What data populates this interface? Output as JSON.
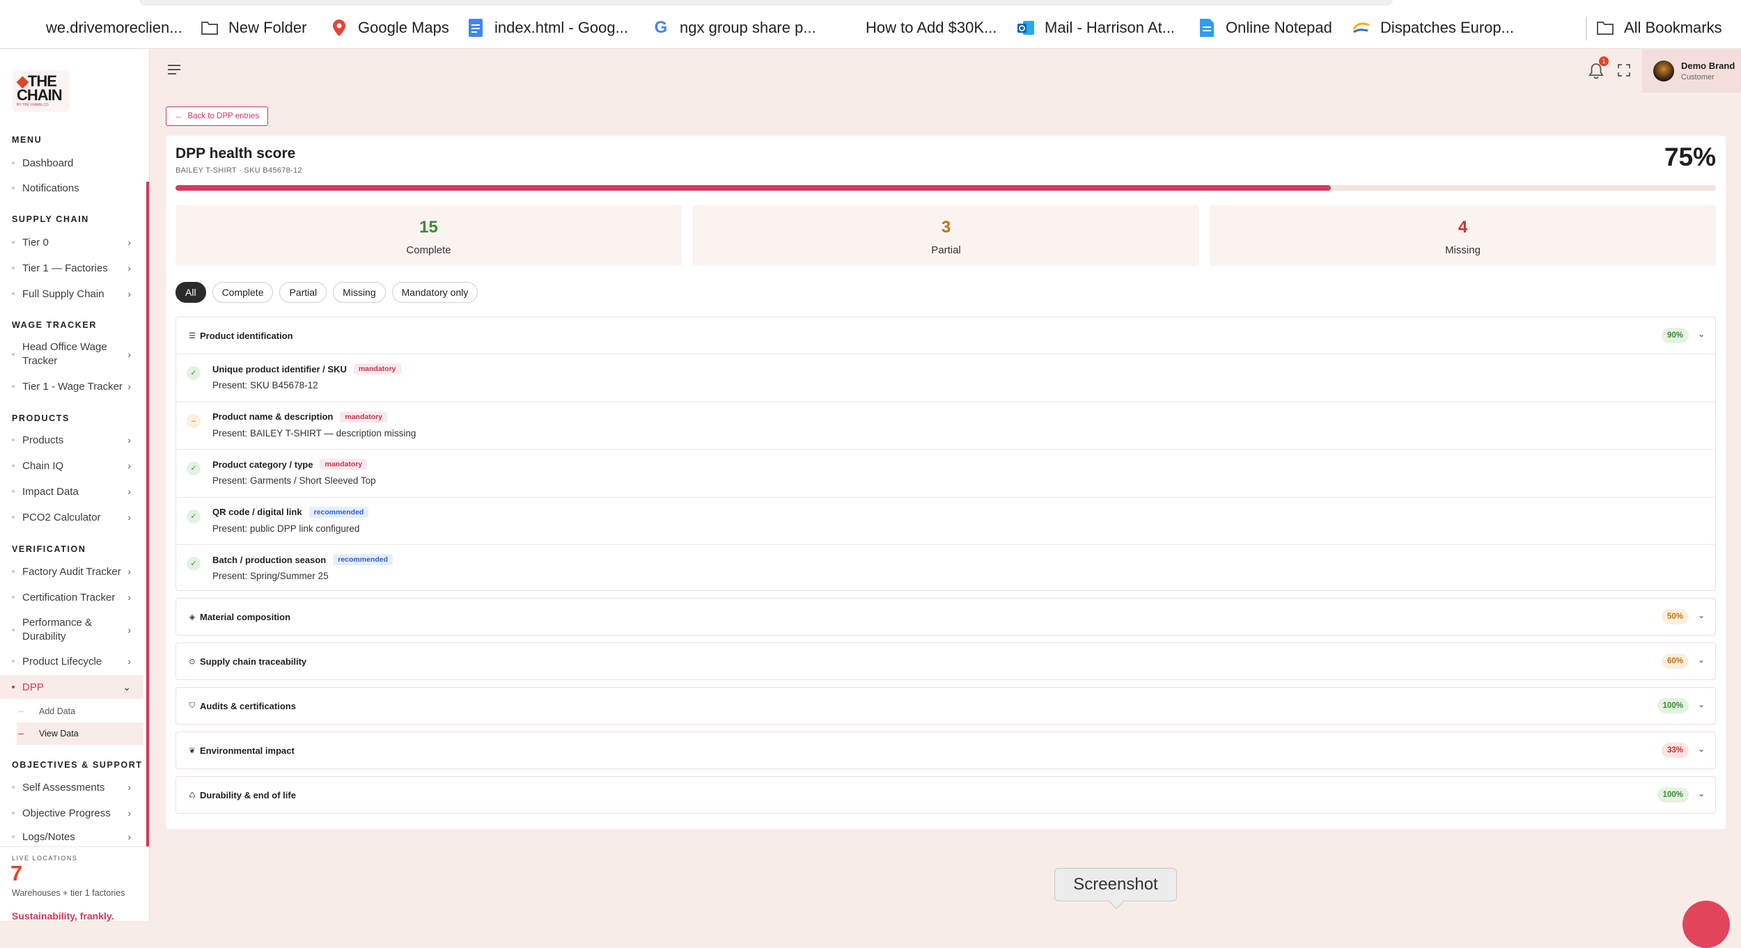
{
  "bookmarks": [
    {
      "label": "we.drivemoreclien...",
      "icon": "none"
    },
    {
      "label": "New Folder",
      "icon": "folder-icon"
    },
    {
      "label": "Google Maps",
      "icon": "maps-pin-icon"
    },
    {
      "label": "index.html - Goog...",
      "icon": "docs-icon"
    },
    {
      "label": "ngx group share p...",
      "icon": "google-g-icon"
    },
    {
      "label": "How to Add $30K...",
      "icon": "none"
    },
    {
      "label": "Mail - Harrison At...",
      "icon": "outlook-icon"
    },
    {
      "label": "Online Notepad",
      "icon": "notepad-icon"
    },
    {
      "label": "Dispatches Europ...",
      "icon": "dispatches-icon"
    },
    {
      "label": "All Bookmarks",
      "icon": "folder-icon"
    }
  ],
  "logo": {
    "line1": "THE",
    "line2": "CHAIN",
    "tagline": "BY THE FRAME.CO"
  },
  "sidebar": {
    "sections": [
      {
        "title": "MENU",
        "items": [
          {
            "label": "Dashboard"
          },
          {
            "label": "Notifications"
          }
        ]
      },
      {
        "title": "SUPPLY CHAIN",
        "items": [
          {
            "label": "Tier 0"
          },
          {
            "label": "Tier 1 — Factories"
          },
          {
            "label": "Full Supply Chain"
          }
        ]
      },
      {
        "title": "WAGE TRACKER",
        "items": [
          {
            "label": "Head Office Wage Tracker"
          },
          {
            "label": "Tier 1 - Wage Tracker"
          }
        ]
      },
      {
        "title": "PRODUCTS",
        "items": [
          {
            "label": "Products"
          },
          {
            "label": "Chain IQ"
          },
          {
            "label": "Impact Data"
          },
          {
            "label": "PCO2 Calculator"
          }
        ]
      },
      {
        "title": "VERIFICATION",
        "items": [
          {
            "label": "Factory Audit Tracker"
          },
          {
            "label": "Certification Tracker"
          },
          {
            "label": "Performance & Durability"
          },
          {
            "label": "Product Lifecycle"
          },
          {
            "label": "DPP"
          }
        ]
      },
      {
        "title": "OBJECTIVES & SUPPORT",
        "items": [
          {
            "label": "Self Assessments"
          },
          {
            "label": "Objective Progress"
          },
          {
            "label": "Logs/Notes"
          }
        ]
      }
    ],
    "dpp_sub": [
      {
        "label": "Add Data"
      },
      {
        "label": "View Data"
      }
    ],
    "live_label": "LIVE LOCATIONS",
    "live_count": "7",
    "live_desc": "Warehouses + tier 1 factories",
    "tagline": "Sustainability, frankly."
  },
  "header": {
    "notif_count": "1",
    "user_name": "Demo Brand",
    "user_role": "Customer"
  },
  "back_label": "Back to DPP entries",
  "health": {
    "title": "DPP health score",
    "subtitle": "BAILEY T-SHIRT · SKU B45678-12",
    "percent": "75%",
    "progress": 0.75
  },
  "stats": [
    {
      "value": "15",
      "label": "Complete",
      "color": "#3d8a3a"
    },
    {
      "value": "3",
      "label": "Partial",
      "color": "#c0731b"
    },
    {
      "value": "4",
      "label": "Missing",
      "color": "#c9332f"
    }
  ],
  "filters": [
    "All",
    "Complete",
    "Partial",
    "Missing",
    "Mandatory only"
  ],
  "expanded": {
    "title": "Product identification",
    "icon": "list-icon",
    "pct": "90%",
    "rows": [
      {
        "title": "Unique product identifier / SKU",
        "tag": "mandatory",
        "present": "Present: SKU B45678-12",
        "status": "complete"
      },
      {
        "title": "Product name & description",
        "tag": "mandatory",
        "present": "Present: BAILEY T-SHIRT — description missing",
        "status": "partial"
      },
      {
        "title": "Product category / type",
        "tag": "mandatory",
        "present": "Present: Garments / Short Sleeved Top",
        "status": "complete"
      },
      {
        "title": "QR code / digital link",
        "tag": "recommended",
        "present": "Present: public DPP link configured",
        "status": "complete"
      },
      {
        "title": "Batch / production season",
        "tag": "recommended",
        "present": "Present: Spring/Summer 25",
        "status": "complete"
      }
    ]
  },
  "collapsed": [
    {
      "title": "Material composition",
      "icon": "layers-icon",
      "pct": "50%",
      "tone": "orange"
    },
    {
      "title": "Supply chain traceability",
      "icon": "location-pin-icon",
      "pct": "60%",
      "tone": "orange"
    },
    {
      "title": "Audits & certifications",
      "icon": "shield-icon",
      "pct": "100%",
      "tone": "green"
    },
    {
      "title": "Environmental impact",
      "icon": "leaf-icon",
      "pct": "33%",
      "tone": "red"
    },
    {
      "title": "Durability & end of life",
      "icon": "recycle-icon",
      "pct": "100%",
      "tone": "green"
    }
  ],
  "screenshot_label": "Screenshot"
}
